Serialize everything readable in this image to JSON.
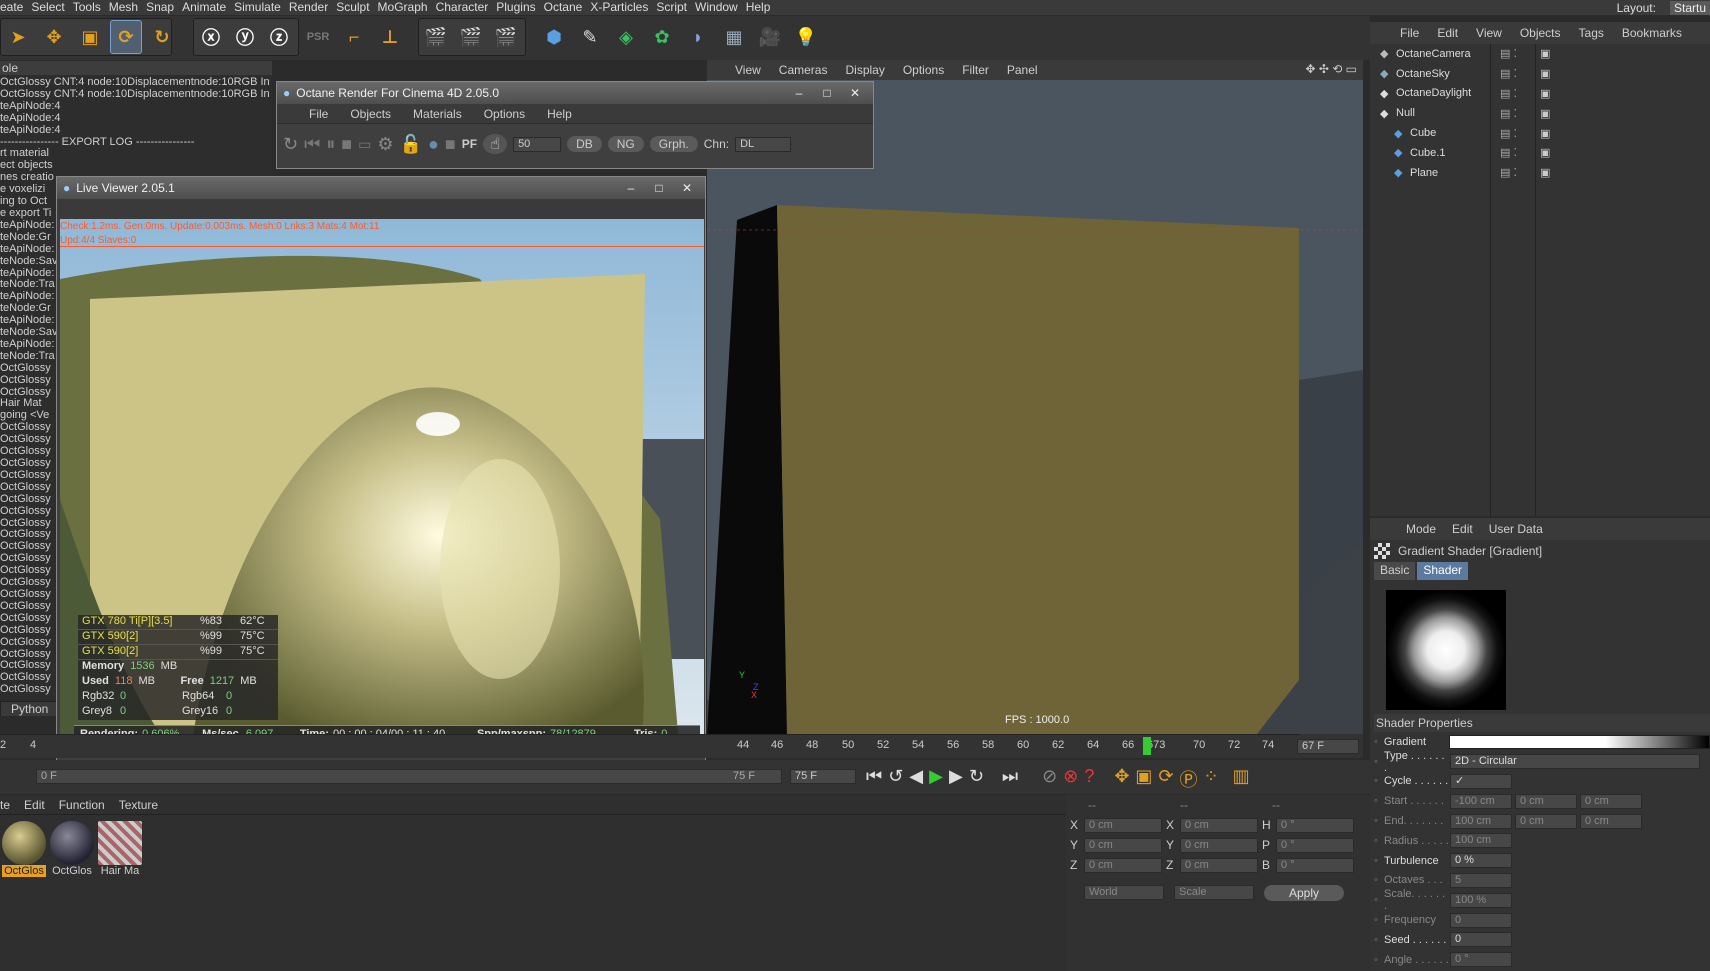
{
  "menubar": {
    "items": [
      "eate",
      "Select",
      "Tools",
      "Mesh",
      "Snap",
      "Animate",
      "Simulate",
      "Render",
      "Sculpt",
      "MoGraph",
      "Character",
      "Plugins",
      "Octane",
      "X-Particles",
      "Script",
      "Window",
      "Help"
    ],
    "layout_label": "Layout:",
    "layout_value": "Startu"
  },
  "console": {
    "title": "ole",
    "lines": [
      "OctGlossy  CNT:4 node:10Displacementnode:10RGB In",
      "OctGlossy  CNT:4 node:10Displacementnode:10RGB In",
      "teApiNode:4",
      "teApiNode:4",
      "teApiNode:4",
      "---------------- EXPORT LOG ----------------",
      "rt material",
      "ect objects",
      "nes creatio",
      "e voxelizi",
      "ing to Oct",
      "e export Ti",
      "teApiNode:",
      "teNode:Gr",
      "teApiNode:",
      "teNode:Sav",
      "teApiNode:",
      "teNode:Tra",
      "teApiNode:",
      "teNode:Gr",
      "teApiNode:",
      "teNode:Sav",
      "teApiNode:",
      "teNode:Tra",
      "OctGlossy",
      "OctGlossy",
      "OctGlossy",
      "Hair Mat",
      "going <Ve",
      "OctGlossy",
      "OctGlossy",
      "OctGlossy",
      "OctGlossy",
      "OctGlossy",
      "OctGlossy",
      "OctGlossy",
      "OctGlossy",
      "OctGlossy",
      "OctGlossy",
      "OctGlossy",
      "OctGlossy",
      "OctGlossy",
      "OctGlossy",
      "OctGlossy",
      "OctGlossy",
      "OctGlossy",
      "OctGlossy",
      "OctGlossy",
      "OctGlossy",
      "OctGlossy",
      "OctGlossy",
      "OctGlossy"
    ],
    "python": "Python"
  },
  "octane": {
    "title": "Octane Render For Cinema 4D 2.05.0",
    "menu": [
      "File",
      "Objects",
      "Materials",
      "Options",
      "Help"
    ],
    "samples": "50",
    "db": "DB",
    "ng": "NG",
    "grph": "Grph.",
    "chn_label": "Chn:",
    "chn_value": "DL"
  },
  "liveviewer": {
    "title": "Live Viewer 2.05.1",
    "status1": "Check:1.2ms. Gen:0ms. Update:0.003ms. Mesh:0 Lnks:3 Mats:4 Mot:11",
    "status2": "Upd:4/4 Slaves:0",
    "gpus": [
      {
        "name": "GTX 780 Ti[P][3.5]",
        "load": "%83",
        "temp": "62°C"
      },
      {
        "name": "GTX 590[2]",
        "load": "%99",
        "temp": "75°C"
      },
      {
        "name": "GTX 590[2]",
        "load": "%99",
        "temp": "75°C"
      }
    ],
    "memory_label": "Memory",
    "memory_value": "1536",
    "memory_unit": "MB",
    "used_label": "Used",
    "used_value": "118",
    "used_unit": "MB",
    "free_label": "Free",
    "free_value": "1217",
    "free_unit": "MB",
    "rgb32_label": "Rgb32",
    "rgb32_value": "0",
    "rgb64_label": "Rgb64",
    "rgb64_value": "0",
    "grey8_label": "Grey8",
    "grey8_value": "0",
    "grey16_label": "Grey16",
    "grey16_value": "0",
    "rendering_label": "Rendering:",
    "rendering_value": "0.606%",
    "mssec_label": "Ms/sec.",
    "mssec_value": "6.097",
    "time_label": "Time:",
    "time_value": "00 : 00 : 04/00 : 11 : 40",
    "spp_label": "Spp/maxspp:",
    "spp_value": "78/12879",
    "tris_label": "Tris:",
    "tris_value": "0"
  },
  "viewport": {
    "menu": [
      "View",
      "Cameras",
      "Display",
      "Options",
      "Filter",
      "Panel"
    ],
    "fps": "FPS : 1000.0",
    "axis_y": "Y",
    "axis_z": "Z",
    "axis_x": "X"
  },
  "objects": {
    "menu": [
      "File",
      "Edit",
      "View",
      "Objects",
      "Tags",
      "Bookmarks"
    ],
    "items": [
      {
        "name": "OctaneCamera",
        "indent": 0
      },
      {
        "name": "OctaneSky",
        "indent": 0
      },
      {
        "name": "OctaneDaylight",
        "indent": 0
      },
      {
        "name": "Null",
        "indent": 0
      },
      {
        "name": "Cube",
        "indent": 1
      },
      {
        "name": "Cube.1",
        "indent": 1
      },
      {
        "name": "Plane",
        "indent": 1
      }
    ]
  },
  "attributes": {
    "menu": [
      "Mode",
      "Edit",
      "User Data"
    ],
    "title": "Gradient Shader [Gradient]",
    "tabs": [
      "Basic",
      "Shader"
    ],
    "section": "Shader Properties",
    "props": [
      {
        "label": "Gradient",
        "value": ""
      },
      {
        "label": "Type . . . . . . .",
        "value": "2D - Circular"
      },
      {
        "label": "Cycle . . . . . .",
        "value": "✓"
      },
      {
        "label": "Start . . . . . .",
        "value": "-100 cm",
        "v2": "0 cm",
        "v3": "0 cm"
      },
      {
        "label": "End. . . . . . .",
        "value": "100 cm",
        "v2": "0 cm",
        "v3": "0 cm"
      },
      {
        "label": "Radius . . . . .",
        "value": "100 cm"
      },
      {
        "label": "Turbulence",
        "value": "0 %"
      },
      {
        "label": "Octaves . . .",
        "value": "5"
      },
      {
        "label": "Scale. . . . . . .",
        "value": "100 %"
      },
      {
        "label": "Frequency",
        "value": "0"
      },
      {
        "label": "Seed . . . . . .",
        "value": "0"
      },
      {
        "label": "Angle . . . . . .",
        "value": "0 °"
      }
    ]
  },
  "timeline": {
    "ticks": [
      "2",
      "4",
      "44",
      "46",
      "48",
      "50",
      "52",
      "54",
      "56",
      "58",
      "60",
      "62",
      "64",
      "66",
      "673",
      "70",
      "72",
      "74"
    ],
    "current": "67 F",
    "start": "0 F",
    "end": "75 F",
    "end2": "75 F"
  },
  "materials": {
    "menu": [
      "te",
      "Edit",
      "Function",
      "Texture"
    ],
    "items": [
      {
        "name": "OctGlos",
        "selected": true
      },
      {
        "name": "OctGlos",
        "selected": false
      },
      {
        "name": "Hair Ma",
        "selected": false
      }
    ]
  },
  "coords": {
    "header": [
      "--",
      "--",
      "--"
    ],
    "rows": [
      {
        "a": "X",
        "av": "0 cm",
        "b": "X",
        "bv": "0 cm",
        "c": "H",
        "cv": "0 °"
      },
      {
        "a": "Y",
        "av": "0 cm",
        "b": "Y",
        "bv": "0 cm",
        "c": "P",
        "cv": "0 °"
      },
      {
        "a": "Z",
        "av": "0 cm",
        "b": "Z",
        "bv": "0 cm",
        "c": "B",
        "cv": "0 °"
      }
    ],
    "world": "World",
    "scale": "Scale",
    "apply": "Apply"
  },
  "colors": {
    "accent": "#f0a020",
    "hud_orange": "#ff5a2a",
    "hud_green": "#7cd080",
    "gpu_yellow": "#e8e040"
  }
}
